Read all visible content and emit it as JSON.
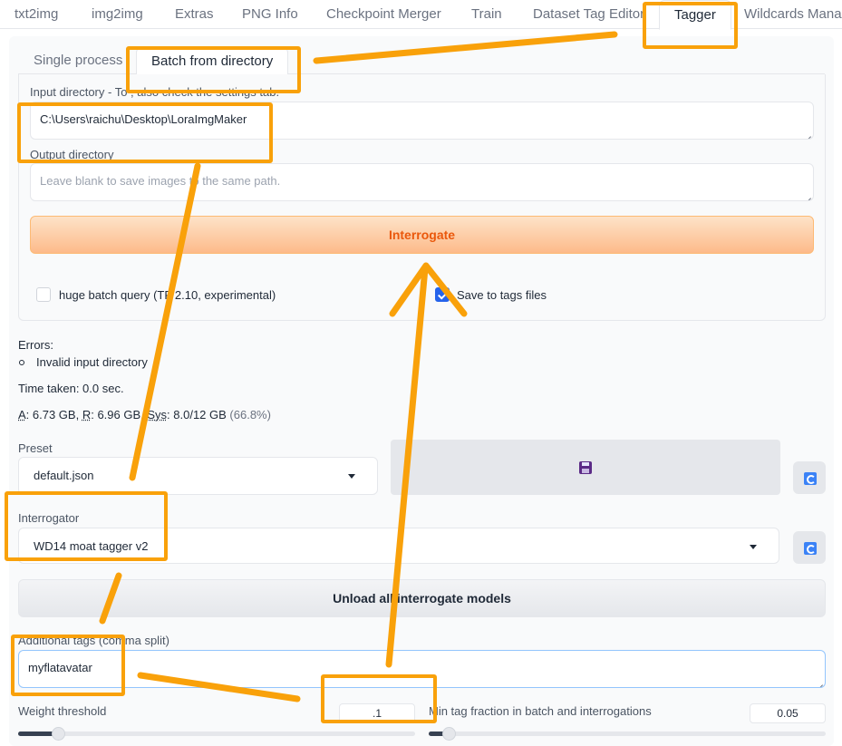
{
  "top_tabs": [
    "txt2img",
    "img2img",
    "Extras",
    "PNG Info",
    "Checkpoint Merger",
    "Train",
    "Dataset Tag Editor",
    "Tagger",
    "Wildcards Manag"
  ],
  "sub_tabs": [
    "Single process",
    "Batch from directory"
  ],
  "input_directory": {
    "label": "Input directory - To ",
    "label_tail": "; also check the settings tab.",
    "value": "C:\\Users\\raichu\\Desktop\\LoraImgMaker"
  },
  "output_directory": {
    "label": "Output directory",
    "placeholder": "Leave blank to save images to the same path."
  },
  "interrogate_button": "Interrogate",
  "checkboxes": {
    "huge_batch": "huge batch query (TF 2.10, experimental)",
    "save_tags": "Save to tags files"
  },
  "errors": {
    "title": "Errors:",
    "item": "Invalid input directory"
  },
  "time_taken": "Time taken: 0.0 sec.",
  "memory": {
    "a_label": "A",
    "a_value": ": 6.73 GB, ",
    "r_label": "R",
    "r_value": ": 6.96 GB, ",
    "s_label": "Sys",
    "s_value": ": 8.0/12 GB",
    "pct": " (66.8%)"
  },
  "preset": {
    "label": "Preset",
    "value": "default.json"
  },
  "interrogator": {
    "label": "Interrogator",
    "value": "WD14 moat tagger v2"
  },
  "unload_button": "Unload all interrogate models",
  "additional_tags": {
    "label": "Additional tags (comma split)",
    "value": "myflatavatar"
  },
  "weight_threshold": {
    "label": "Weight threshold",
    "value": ".1",
    "fraction": 0.1
  },
  "min_tag_fraction": {
    "label": "Min tag fraction in batch and interrogations",
    "value": "0.05",
    "fraction": 0.05
  },
  "annotation_color": "#f9a10a"
}
